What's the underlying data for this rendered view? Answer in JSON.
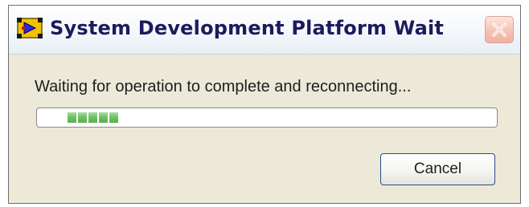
{
  "window": {
    "title": "System Development Platform Wait",
    "app_icon": "labview-vi-icon",
    "close_icon": "close-x-icon"
  },
  "dialog": {
    "message": "Waiting for operation to complete and reconnecting...",
    "progress": {
      "style": "indeterminate-marquee",
      "visible_segments": 5,
      "color": "#6cbf62"
    },
    "cancel_label": "Cancel"
  },
  "colors": {
    "title_text": "#1b1b5c",
    "dialog_background": "#ece9d8",
    "close_button": "#f0b0a1"
  }
}
